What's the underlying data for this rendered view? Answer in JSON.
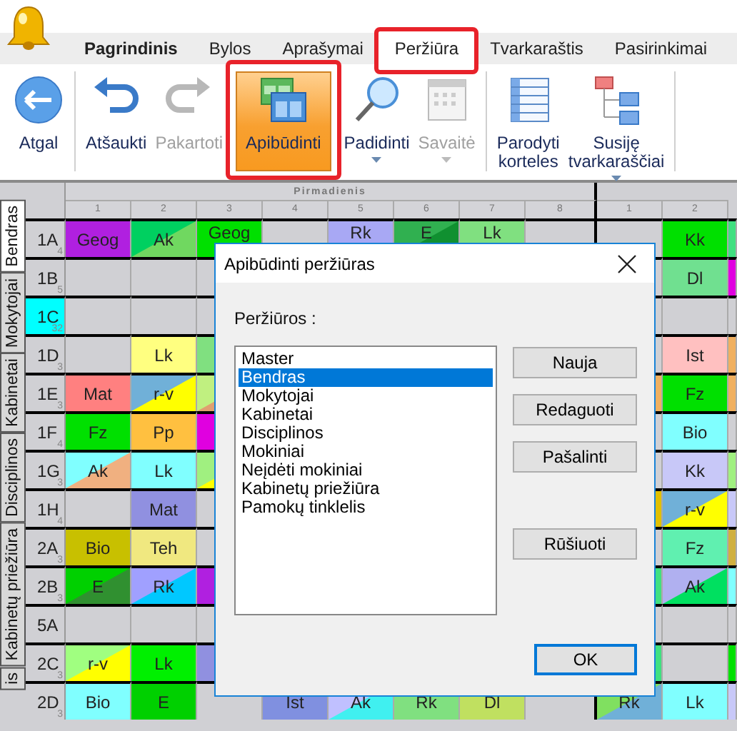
{
  "menu_tabs": [
    {
      "label": "Pagrindinis",
      "selected": false,
      "bold": true,
      "highlighted": false
    },
    {
      "label": "Bylos",
      "selected": false,
      "bold": false,
      "highlighted": false
    },
    {
      "label": "Aprašymai",
      "selected": false,
      "bold": false,
      "highlighted": false
    },
    {
      "label": "Peržiūra",
      "selected": true,
      "bold": false,
      "highlighted": true
    },
    {
      "label": "Tvarkaraštis",
      "selected": false,
      "bold": false,
      "highlighted": false
    },
    {
      "label": "Pasirinkimai",
      "selected": false,
      "bold": false,
      "highlighted": false
    }
  ],
  "ribbon": [
    {
      "kind": "back",
      "lines": [
        "Atgal"
      ],
      "disabled": false,
      "selected": false,
      "highlighted": false,
      "dropdown": false
    },
    {
      "kind": "separator"
    },
    {
      "kind": "undo",
      "lines": [
        "Atšaukti"
      ],
      "disabled": false,
      "selected": false,
      "highlighted": false,
      "dropdown": false
    },
    {
      "kind": "redo",
      "lines": [
        "Pakartoti"
      ],
      "disabled": true,
      "selected": false,
      "highlighted": false,
      "dropdown": false
    },
    {
      "kind": "describe",
      "lines": [
        "Apibūdinti"
      ],
      "disabled": false,
      "selected": true,
      "highlighted": true,
      "dropdown": false
    },
    {
      "kind": "zoom",
      "lines": [
        "Padidinti"
      ],
      "disabled": false,
      "selected": false,
      "highlighted": false,
      "dropdown": true
    },
    {
      "kind": "week",
      "lines": [
        "Savaitė"
      ],
      "disabled": true,
      "selected": false,
      "highlighted": false,
      "dropdown": true
    },
    {
      "kind": "separator"
    },
    {
      "kind": "cards",
      "lines": [
        "Parodyti",
        "korteles"
      ],
      "disabled": false,
      "selected": false,
      "highlighted": false,
      "dropdown": false
    },
    {
      "kind": "related",
      "lines": [
        "Susiję",
        "tvarkaraščiai"
      ],
      "disabled": false,
      "selected": false,
      "highlighted": false,
      "dropdown": true
    },
    {
      "kind": "separator"
    }
  ],
  "view_tabs": [
    {
      "label": "Bendras",
      "selected": true
    },
    {
      "label": "Mokytojai",
      "selected": false
    },
    {
      "label": "Kabinetai",
      "selected": false
    },
    {
      "label": "Disciplinos",
      "selected": false
    },
    {
      "label": "Kabinetų priežiūra",
      "selected": false
    },
    {
      "label": "is",
      "selected": false
    }
  ],
  "timetable": {
    "day": "Pirmadienis",
    "periods": [
      "1",
      "2",
      "3",
      "4",
      "5",
      "6",
      "7",
      "8",
      "1",
      "2"
    ],
    "rows": [
      {
        "name": "1A",
        "count": "4",
        "selected": false,
        "monday": [
          {
            "kind": "lesson",
            "text": "Geog",
            "color": "#b020e0"
          },
          {
            "kind": "split",
            "text": "Ak",
            "color": "#00d060",
            "corner": {
              "color": "#70d860"
            }
          },
          {
            "kind": "lesson",
            "text": "Geog",
            "color": "#00e000"
          },
          {
            "kind": "empty"
          },
          {
            "kind": "lesson",
            "text": "Rk",
            "color": "#a8a8f4"
          },
          {
            "kind": "split",
            "text": "E",
            "color": "#30b050",
            "corner": {
              "color": "#109030"
            }
          },
          {
            "kind": "lesson",
            "text": "Lk",
            "color": "#80e080"
          },
          {
            "kind": "empty"
          }
        ],
        "tuesday": [
          {
            "kind": "empty"
          },
          {
            "kind": "lesson",
            "text": "Kk",
            "color": "#00e000"
          },
          {
            "kind": "lesson",
            "color": "#40e080"
          }
        ]
      },
      {
        "name": "1B",
        "count": "5",
        "selected": false,
        "monday": [
          {
            "kind": "empty"
          },
          {
            "kind": "empty"
          },
          {
            "kind": "empty"
          }
        ],
        "tuesday": [
          {
            "kind": "empty"
          },
          {
            "kind": "lesson",
            "text": "Dl",
            "color": "#70e090"
          },
          {
            "kind": "lesson",
            "color": "#e000e0"
          }
        ]
      },
      {
        "name": "1C",
        "count": "32",
        "selected": true,
        "monday": [
          {
            "kind": "empty"
          },
          {
            "kind": "empty"
          },
          {
            "kind": "empty"
          }
        ],
        "tuesday": [
          {
            "kind": "empty"
          },
          {
            "kind": "empty"
          },
          {
            "kind": "empty"
          }
        ]
      },
      {
        "name": "1D",
        "count": "3",
        "selected": false,
        "monday": [
          {
            "kind": "empty"
          },
          {
            "kind": "lesson",
            "text": "Lk",
            "color": "#ffff80"
          },
          {
            "kind": "lesson",
            "color": "#80e080"
          }
        ],
        "tuesday": [
          {
            "kind": "empty"
          },
          {
            "kind": "lesson",
            "text": "Ist",
            "color": "#ffc0c0"
          },
          {
            "kind": "lesson",
            "color": "#f0b060"
          }
        ]
      },
      {
        "name": "1E",
        "count": "3",
        "selected": false,
        "monday": [
          {
            "kind": "lesson",
            "text": "Mat",
            "color": "#ff8080"
          },
          {
            "kind": "split",
            "text": "r-v",
            "color": "#70b0d8",
            "corner": {
              "color": "#ffff00"
            }
          },
          {
            "kind": "split",
            "color": "#c0f080",
            "corner": {
              "color": "#e0a070"
            }
          }
        ],
        "tuesday": [
          {
            "kind": "lesson",
            "color": "#f0b060"
          },
          {
            "kind": "lesson",
            "text": "Fz",
            "color": "#00e000"
          },
          {
            "kind": "lesson",
            "color": "#f0b060"
          }
        ]
      },
      {
        "name": "1F",
        "count": "4",
        "selected": false,
        "monday": [
          {
            "kind": "lesson",
            "text": "Fz",
            "color": "#00e000"
          },
          {
            "kind": "lesson",
            "text": "Pp",
            "color": "#ffc040"
          },
          {
            "kind": "lesson",
            "color": "#e000e0"
          }
        ],
        "tuesday": [
          {
            "kind": "empty"
          },
          {
            "kind": "lesson",
            "text": "Bio",
            "color": "#80ffff"
          },
          {
            "kind": "empty"
          }
        ]
      },
      {
        "name": "1G",
        "count": "3",
        "selected": false,
        "monday": [
          {
            "kind": "split",
            "text": "Ak",
            "color": "#80ffff",
            "corner": {
              "color": "#f0b080"
            }
          },
          {
            "kind": "lesson",
            "text": "Lk",
            "color": "#80ffff"
          },
          {
            "kind": "split",
            "color": "#a0f080",
            "corner": {
              "color": "#ffff00"
            }
          }
        ],
        "tuesday": [
          {
            "kind": "empty"
          },
          {
            "kind": "lesson",
            "text": "Kk",
            "color": "#c8c8f8"
          },
          {
            "kind": "lesson",
            "color": "#a0f080"
          }
        ]
      },
      {
        "name": "1H",
        "count": "4",
        "selected": false,
        "monday": [
          {
            "kind": "empty"
          },
          {
            "kind": "lesson",
            "text": "Mat",
            "color": "#9090e0"
          },
          {
            "kind": "empty"
          }
        ],
        "tuesday": [
          {
            "kind": "lesson",
            "color": "#e0c000"
          },
          {
            "kind": "split",
            "text": "r-v",
            "color": "#70b0d8",
            "corner": {
              "color": "#ffff00"
            }
          },
          {
            "kind": "lesson",
            "color": "#c8c8f8"
          }
        ]
      },
      {
        "name": "2A",
        "count": "3",
        "selected": false,
        "monday": [
          {
            "kind": "lesson",
            "text": "Bio",
            "color": "#c8c000"
          },
          {
            "kind": "lesson",
            "text": "Teh",
            "color": "#f0e880"
          },
          {
            "kind": "empty"
          }
        ],
        "tuesday": [
          {
            "kind": "empty"
          },
          {
            "kind": "lesson",
            "text": "Fz",
            "color": "#60f0b0"
          },
          {
            "kind": "lesson",
            "color": "#d0b040"
          }
        ]
      },
      {
        "name": "2B",
        "count": "3",
        "selected": false,
        "monday": [
          {
            "kind": "split",
            "text": "E",
            "color": "#00d000",
            "corner": {
              "color": "#309030"
            }
          },
          {
            "kind": "split",
            "text": "Rk",
            "color": "#a0a0ff",
            "corner": {
              "color": "#00c8ff"
            }
          },
          {
            "kind": "lesson",
            "color": "#b020e0"
          }
        ],
        "tuesday": [
          {
            "kind": "lesson",
            "color": "#40e080"
          },
          {
            "kind": "split",
            "text": "Ak",
            "color": "#b0b0f0",
            "corner": {
              "color": "#00e060"
            }
          },
          {
            "kind": "lesson",
            "color": "#80ffff"
          }
        ]
      },
      {
        "name": "5A",
        "selected": false,
        "monday": [
          {
            "kind": "empty"
          },
          {
            "kind": "empty"
          },
          {
            "kind": "empty"
          }
        ],
        "tuesday": [
          {
            "kind": "empty"
          },
          {
            "kind": "empty"
          },
          {
            "kind": "empty"
          }
        ]
      },
      {
        "name": "2C",
        "count": "3",
        "selected": false,
        "monday": [
          {
            "kind": "split",
            "text": "r-v",
            "color": "#a0ff80",
            "corner": {
              "color": "#ffff00"
            }
          },
          {
            "kind": "lesson",
            "text": "Lk",
            "color": "#00f000"
          },
          {
            "kind": "lesson",
            "color": "#9090e0"
          }
        ],
        "tuesday": [
          {
            "kind": "lesson",
            "color": "#40e080"
          },
          {
            "kind": "empty"
          },
          {
            "kind": "lesson",
            "color": "#00e000"
          }
        ]
      },
      {
        "name": "2D",
        "count": "3",
        "selected": false,
        "monday": [
          {
            "kind": "lesson",
            "text": "Bio",
            "color": "#80ffff"
          },
          {
            "kind": "lesson",
            "text": "E",
            "color": "#00d000"
          },
          {
            "kind": "empty"
          },
          {
            "kind": "lesson",
            "text": "Ist",
            "color": "#8090e0"
          },
          {
            "kind": "split",
            "text": "Ak",
            "color": "#c0c0ff",
            "corner": {
              "color": "#40f0f0"
            }
          },
          {
            "kind": "lesson",
            "text": "Rk",
            "color": "#80e080"
          },
          {
            "kind": "lesson",
            "text": "Dl",
            "color": "#c0e060"
          },
          {
            "kind": "empty"
          }
        ],
        "tuesday": [
          {
            "kind": "split",
            "text": "Rk",
            "color": "#80e060",
            "corner": {
              "color": "#70b0d8"
            }
          },
          {
            "kind": "lesson",
            "text": "Lk",
            "color": "#80ffff"
          },
          {
            "kind": "lesson",
            "color": "#c8c8f8"
          }
        ]
      }
    ]
  },
  "dialog": {
    "title": "Apibūdinti peržiūras",
    "list_label": "Peržiūros :",
    "items": [
      {
        "label": "Master",
        "selected": false
      },
      {
        "label": "Bendras",
        "selected": true
      },
      {
        "label": "Mokytojai",
        "selected": false
      },
      {
        "label": "Kabinetai",
        "selected": false
      },
      {
        "label": "Disciplinos",
        "selected": false
      },
      {
        "label": "Mokiniai",
        "selected": false
      },
      {
        "label": "Neįdėti mokiniai",
        "selected": false
      },
      {
        "label": "Kabinetų priežiūra",
        "selected": false
      },
      {
        "label": "Pamokų tinklelis",
        "selected": false
      }
    ],
    "side_buttons": [
      {
        "label": "Nauja",
        "kind": "action"
      },
      {
        "label": "Redaguoti",
        "kind": "action"
      },
      {
        "label": "Pašalinti",
        "kind": "action"
      },
      {
        "label": "Rūšiuoti",
        "kind": "sort"
      }
    ],
    "ok_button": {
      "label": "OK",
      "default": true
    }
  }
}
